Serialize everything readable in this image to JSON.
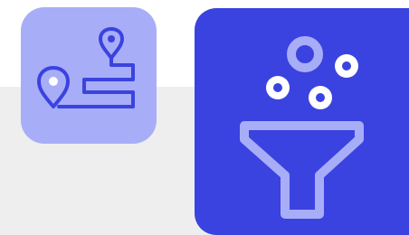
{
  "icons": {
    "route": {
      "name": "map-route-icon",
      "background": "#a8adf7",
      "stroke": "#3a43e0",
      "pin_fill": "#3a43e0",
      "pin_center": "#ffffff"
    },
    "funnel": {
      "name": "funnel-filter-icon",
      "background": "#3a43e0",
      "outline": "#a8adf7",
      "dots": "#ffffff"
    }
  },
  "colors": {
    "page": "#ffffff",
    "band": "#eeeeee"
  }
}
